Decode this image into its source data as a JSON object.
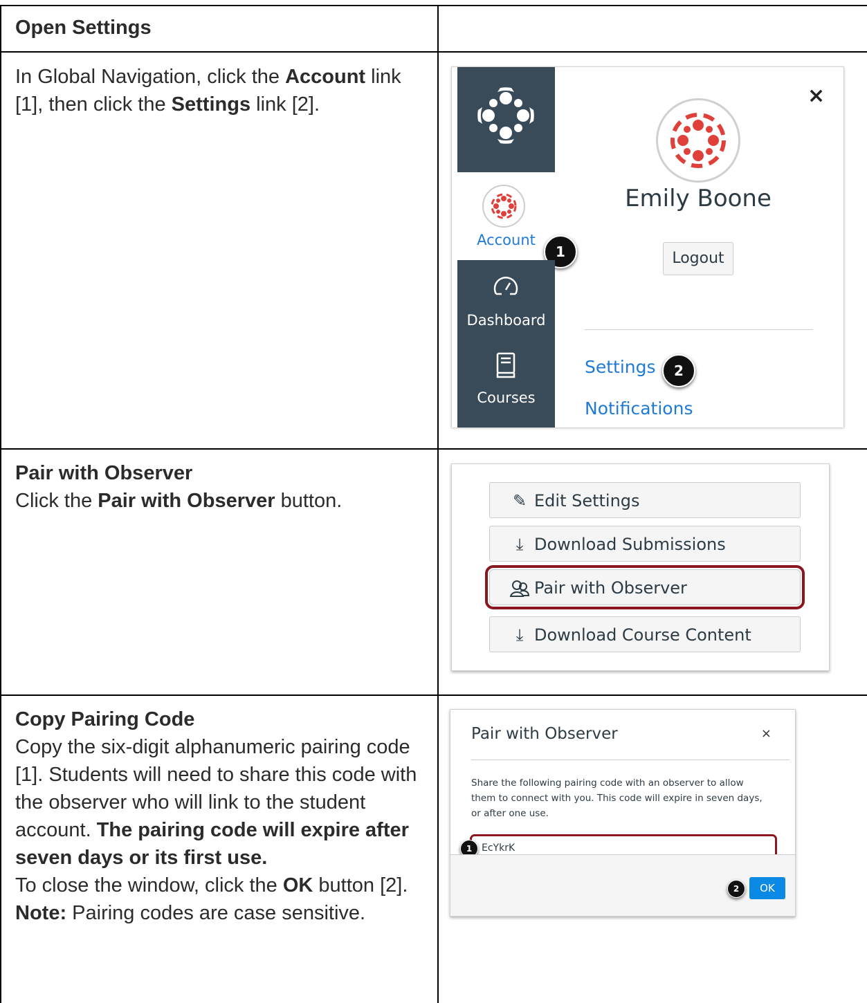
{
  "rows": [
    {
      "heading": "Open Settings"
    },
    {
      "text_parts": [
        "In Global Navigation, click the ",
        "Account",
        " link [1], then click the ",
        "Settings",
        " link [2]."
      ]
    },
    {
      "heading": "Pair with Observer",
      "text_parts": [
        "Click the ",
        "Pair with Observer",
        " button."
      ]
    },
    {
      "heading": "Copy Pairing Code",
      "text_parts": [
        "Copy the six-digit alphanumeric pairing code [1]. Students will need to share this code with the observer who will link to the student account. ",
        "The pairing code will expire after seven days or its first use.",
        "To close the window, click the ",
        "OK",
        " button [2].",
        "Note:",
        " Pairing codes are case sensitive."
      ]
    }
  ],
  "account_panel": {
    "user_name": "Emily Boone",
    "logout_label": "Logout",
    "close_glyph": "×",
    "nav": {
      "account": "Account",
      "dashboard": "Dashboard",
      "courses": "Courses"
    },
    "links": {
      "settings": "Settings",
      "notifications": "Notifications"
    },
    "callouts": [
      "1",
      "2"
    ],
    "brand_color": "#e0403a",
    "nav_bg": "#394b58"
  },
  "settings_buttons": {
    "edit": "Edit Settings",
    "download_submissions": "Download Submissions",
    "pair": "Pair with Observer",
    "download_content": "Download Course Content",
    "icons": [
      "pencil-icon",
      "download-icon",
      "users-icon",
      "download-icon"
    ]
  },
  "pair_modal": {
    "title": "Pair with Observer",
    "close_glyph": "×",
    "description": "Share the following pairing code with an observer to allow them to connect with you. This code will expire in seven days, or after one use.",
    "code": "EcYkrK",
    "ok_label": "OK",
    "callouts": [
      "1",
      "2"
    ],
    "highlight_color": "#8a1620",
    "ok_color": "#0b8ae5"
  }
}
